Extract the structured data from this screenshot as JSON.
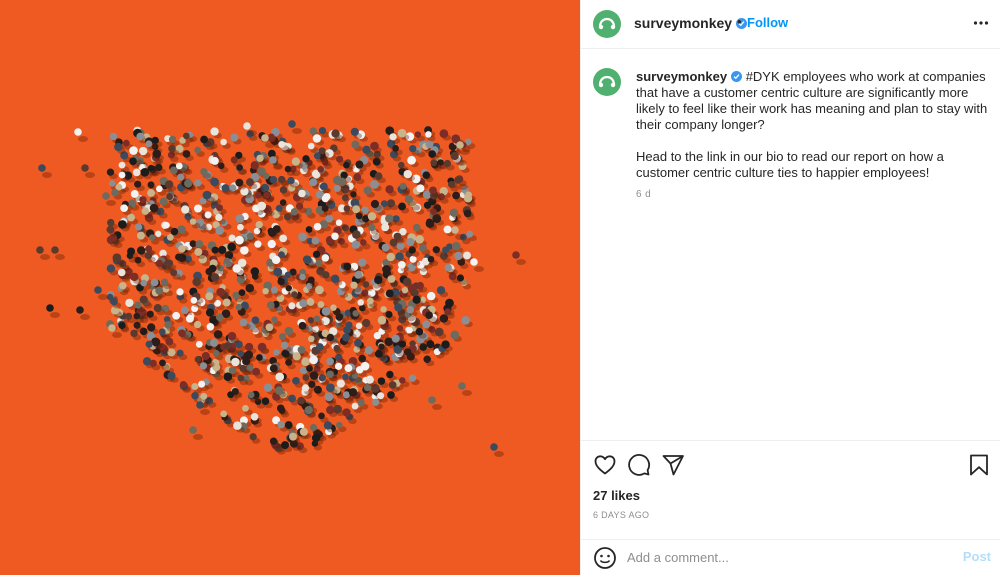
{
  "colors": {
    "media_background": "#ef5a23",
    "brand_avatar": "#4fb06f",
    "follow_link": "#0095f6",
    "post_disabled": "#b2dffc"
  },
  "media": {
    "description_icon": "heart-crowd-image"
  },
  "header": {
    "username": "surveymonkey",
    "verified_icon": "verified-badge-icon",
    "separator": "•",
    "follow_label": "Follow",
    "more_icon": "more-options-icon"
  },
  "caption": {
    "username": "surveymonkey",
    "paragraph1": "#DYK employees who work at companies that have a customer centric culture are significantly more likely to feel like their work has meaning and plan to stay with their company longer?",
    "paragraph2": "Head to the link in our bio to read our report on how a customer centric culture ties to happier employees!",
    "time": "6 d"
  },
  "actions": {
    "like_icon": "heart-icon",
    "comment_icon": "comment-icon",
    "share_icon": "paper-plane-icon",
    "save_icon": "bookmark-icon",
    "likes": "27 likes",
    "date": "6 DAYS AGO"
  },
  "comment_box": {
    "emoji_icon": "smiley-icon",
    "placeholder": "Add a comment...",
    "post_label": "Post"
  }
}
